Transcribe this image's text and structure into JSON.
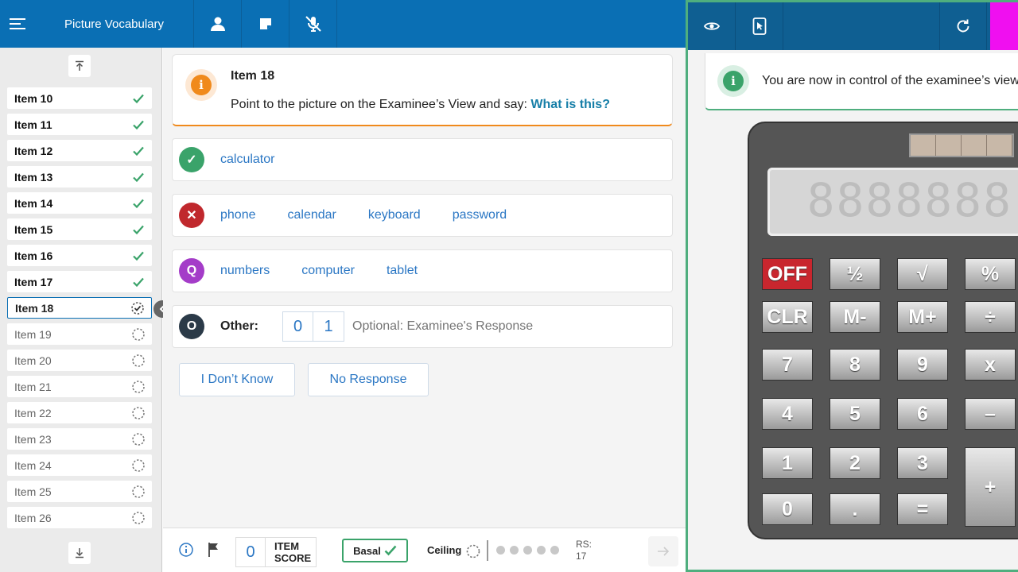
{
  "topbar": {
    "title": "Picture Vocabulary"
  },
  "sidebar": {
    "items": [
      {
        "label": "Item 10",
        "state": "done"
      },
      {
        "label": "Item 11",
        "state": "done"
      },
      {
        "label": "Item 12",
        "state": "done"
      },
      {
        "label": "Item 13",
        "state": "done"
      },
      {
        "label": "Item 14",
        "state": "done"
      },
      {
        "label": "Item 15",
        "state": "done"
      },
      {
        "label": "Item 16",
        "state": "done"
      },
      {
        "label": "Item 17",
        "state": "done"
      },
      {
        "label": "Item 18",
        "state": "active"
      },
      {
        "label": "Item 19",
        "state": "pending"
      },
      {
        "label": "Item 20",
        "state": "pending"
      },
      {
        "label": "Item 21",
        "state": "pending"
      },
      {
        "label": "Item 22",
        "state": "pending"
      },
      {
        "label": "Item 23",
        "state": "pending"
      },
      {
        "label": "Item 24",
        "state": "pending"
      },
      {
        "label": "Item 25",
        "state": "pending"
      },
      {
        "label": "Item 26",
        "state": "pending"
      }
    ]
  },
  "prompt": {
    "item_title": "Item 18",
    "instruction": "Point to the picture on the Examinee’s View and say: ",
    "question": "What is this?"
  },
  "responses": {
    "correct": {
      "icon_symbol": "✓",
      "color": "#3aa36a",
      "words": [
        "calculator"
      ]
    },
    "incorrect": {
      "icon_symbol": "✕",
      "color": "#c0282d",
      "words": [
        "phone",
        "calendar",
        "keyboard",
        "password"
      ]
    },
    "query": {
      "icon_symbol": "Q",
      "color": "#a43cc8",
      "words": [
        "numbers",
        "computer",
        "tablet"
      ]
    },
    "other": {
      "icon_symbol": "O",
      "color": "#2b3a48",
      "label": "Other:",
      "scores": [
        "0",
        "1"
      ],
      "placeholder": "Optional: Examinee's Response"
    }
  },
  "actions": {
    "dont_know": "I Don’t Know",
    "no_response": "No Response"
  },
  "footer": {
    "item_score_value": "0",
    "item_score_label_line1": "ITEM",
    "item_score_label_line2": "SCORE",
    "basal_label": "Basal",
    "ceiling_label": "Ceiling",
    "rs_label": "RS:",
    "rs_value": "17"
  },
  "examinee": {
    "notice": "You are now in control of the examinee’s view",
    "lcd_display": "8888888",
    "keys": [
      [
        "OFF",
        "½",
        "√",
        "%"
      ],
      [
        "CLR",
        "M-",
        "M+",
        "÷"
      ],
      [
        "7",
        "8",
        "9",
        "x"
      ],
      [
        "4",
        "5",
        "6",
        "–"
      ],
      [
        "1",
        "2",
        "3",
        "+"
      ],
      [
        "0",
        ".",
        "="
      ]
    ]
  },
  "colors": {
    "primary": "#0a6fb4",
    "accent_orange": "#f08a1c",
    "success_green": "#3aa36a",
    "magenta": "#f00ff0"
  }
}
